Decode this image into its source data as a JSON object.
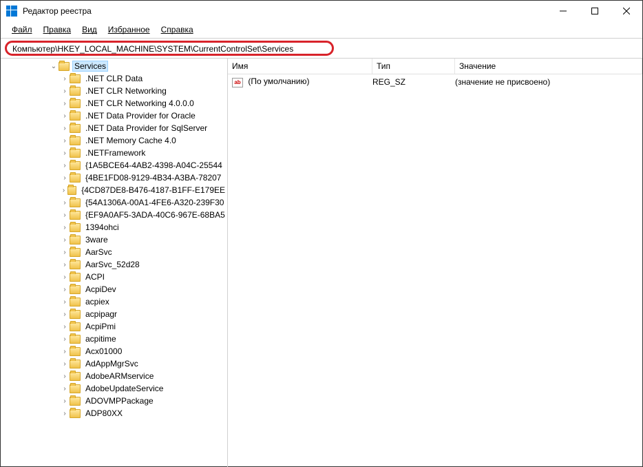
{
  "window": {
    "title": "Редактор реестра"
  },
  "menu": {
    "file": "Файл",
    "edit": "Правка",
    "view": "Вид",
    "favorites": "Избранное",
    "help": "Справка"
  },
  "address": "Компьютер\\HKEY_LOCAL_MACHINE\\SYSTEM\\CurrentControlSet\\Services",
  "columns": {
    "name": "Имя",
    "type": "Тип",
    "value": "Значение"
  },
  "row": {
    "name": "(По умолчанию)",
    "type": "REG_SZ",
    "value": "(значение не присвоено)"
  },
  "tree": {
    "selected": "Services",
    "children": [
      ".NET CLR Data",
      ".NET CLR Networking",
      ".NET CLR Networking 4.0.0.0",
      ".NET Data Provider for Oracle",
      ".NET Data Provider for SqlServer",
      ".NET Memory Cache 4.0",
      ".NETFramework",
      "{1A5BCE64-4AB2-4398-A04C-25544",
      "{4BE1FD08-9129-4B34-A3BA-78207",
      "{4CD87DE8-B476-4187-B1FF-E179EE",
      "{54A1306A-00A1-4FE6-A320-239F30",
      "{EF9A0AF5-3ADA-40C6-967E-68BA5",
      "1394ohci",
      "3ware",
      "AarSvc",
      "AarSvc_52d28",
      "ACPI",
      "AcpiDev",
      "acpiex",
      "acpipagr",
      "AcpiPmi",
      "acpitime",
      "Acx01000",
      "AdAppMgrSvc",
      "AdobeARMservice",
      "AdobeUpdateService",
      "ADOVMPPackage",
      "ADP80XX"
    ]
  }
}
